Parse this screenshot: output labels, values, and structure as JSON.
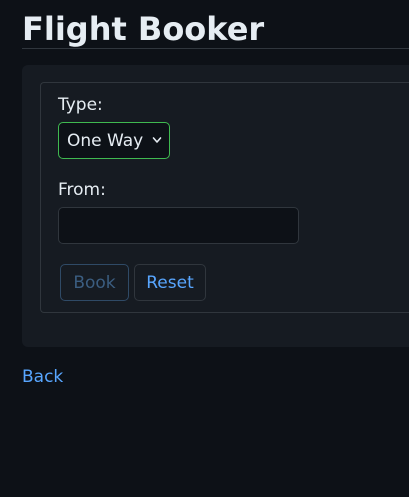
{
  "page": {
    "title": "Flight Booker"
  },
  "form": {
    "type_label": "Type:",
    "type_selected": "One Way",
    "from_label": "From:",
    "from_value": "",
    "book_label": "Book",
    "reset_label": "Reset",
    "book_enabled": false
  },
  "nav": {
    "back_label": "Back"
  },
  "colors": {
    "background": "#0d1117",
    "panel": "#161b22",
    "accent": "#58a6ff",
    "select_border": "#3fb950"
  },
  "icons": {
    "select_chevron": "chevron-down-icon"
  }
}
